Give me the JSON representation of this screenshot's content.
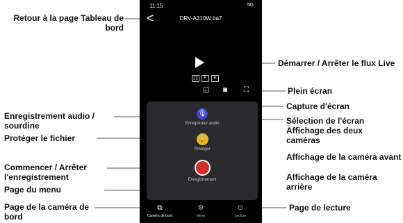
{
  "phone": {
    "status_time": "11:15",
    "status_signal": "5G",
    "title": "DRV-A310W ba7",
    "back_glyph": "<",
    "buttons": {
      "audio_label": "Enregistreur audio",
      "protect_label": "Protéger",
      "record_label": "Enregistrement"
    },
    "nav": {
      "dashcam": "Caméra de bord",
      "menu": "Menu",
      "playback": "Lecture"
    }
  },
  "callouts": {
    "back": "Retour à la page Tableau de bord",
    "live_stream": "Démarrer / Arrêter le flux Live",
    "fullscreen": "Plein écran",
    "capture": "Capture d'écran",
    "screen_select": "Sélection de l'écran",
    "both_cameras": "Affichage des deux caméras",
    "front_camera": "Affichage de la caméra avant",
    "rear_camera": "Affichage de la caméra arrière",
    "audio_mute": "Enregistrement audio / sourdine",
    "protect_file": "Protéger le fichier",
    "start_stop_record": "Commencer / Arrêter l'enregistrement",
    "menu_page": "Page du menu",
    "dashcam_page": "Page de la caméra de bord",
    "playback_page": "Page de lecture"
  },
  "colors": {
    "audio_button": "#3f47d8",
    "protect_button": "#e8b81e",
    "record_button": "#d42a2a",
    "panel": "#2a2a2d"
  }
}
